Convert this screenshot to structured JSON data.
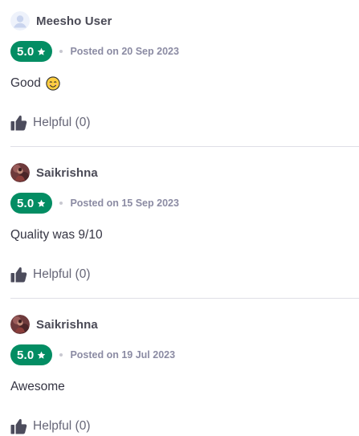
{
  "reviews": [
    {
      "user_name": "Meesho User",
      "avatar_icon": "default-user-icon",
      "rating": "5.0",
      "posted": "Posted on 20 Sep 2023",
      "text": "Good",
      "emoji": "smiling-face-icon",
      "helpful_label": "Helpful (0)"
    },
    {
      "user_name": "Saikrishna",
      "avatar_icon": "profile-photo",
      "rating": "5.0",
      "posted": "Posted on 15 Sep 2023",
      "text": "Quality was 9/10",
      "helpful_label": "Helpful (0)"
    },
    {
      "user_name": "Saikrishna",
      "avatar_icon": "profile-photo",
      "rating": "5.0",
      "posted": "Posted on 19 Jul 2023",
      "text": "Awesome",
      "helpful_label": "Helpful (0)"
    }
  ],
  "colors": {
    "rating_badge": "#038d63",
    "text_primary": "#353543",
    "text_secondary": "#8b8ba3",
    "divider": "#dfdfe6"
  }
}
